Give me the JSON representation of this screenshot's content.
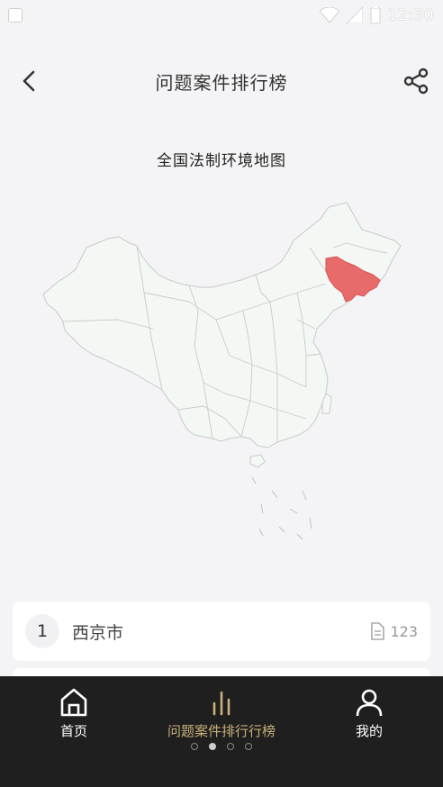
{
  "status_bar": {
    "time": "12:30"
  },
  "header": {
    "title": "问题案件排行榜"
  },
  "map": {
    "title": "全国法制环境地图",
    "base_fill": "#f3f8f5",
    "border_color": "#c9c9c9",
    "highlight_fill": "#e86b6b"
  },
  "ranking": [
    {
      "rank": "1",
      "name": "西京市",
      "count": "123"
    }
  ],
  "tabbar": {
    "tabs": [
      {
        "label": "首页"
      },
      {
        "label": "问题案件排行行榜"
      },
      {
        "label": "我的"
      }
    ],
    "active_color": "#c9b07a"
  }
}
